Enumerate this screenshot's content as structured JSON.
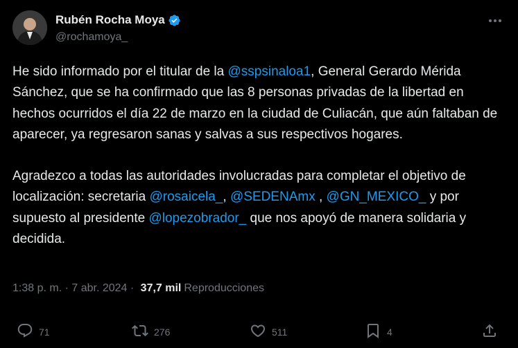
{
  "author": {
    "name": "Rubén Rocha Moya",
    "handle": "@rochamoya_"
  },
  "tweet": {
    "p1_before_mention": "He sido informado por el titular de la ",
    "p1_mention": "@sspsinaloa1",
    "p1_after": ", General Gerardo Mérida Sánchez, que se ha confirmado que las 8 personas privadas de la libertad en hechos ocurridos el día 22 de marzo en la ciudad de Culiacán, que aún faltaban de aparecer, ya regresaron sanas y salvas a sus respectivos hogares.",
    "p2_before_mentions": "Agradezco a todas las autoridades involucradas para completar el objetivo de localización: secretaria ",
    "mention_rosaicela": "@rosaicela_",
    "sep1": ", ",
    "mention_sedena": "@SEDENAmx",
    "sep2": " , ",
    "mention_gn": "@GN_MEXICO_",
    "between_gn_president": " y por supuesto al presidente ",
    "mention_amlo": "@lopezobrador_",
    "p2_end": " que nos apoyó de manera solidaria y decidida."
  },
  "meta": {
    "time": "1:38 p. m.",
    "dot1": " · ",
    "date": "7 abr. 2024",
    "dot2": " · ",
    "views_count": "37,7 mil",
    "views_label": "Reproducciones"
  },
  "actions": {
    "replies": "71",
    "retweets": "276",
    "likes": "511",
    "bookmarks": "4"
  },
  "colors": {
    "background": "#000000",
    "text": "#e7e9ea",
    "secondary": "#71767b",
    "accent": "#1d9bf0"
  },
  "icons": [
    "more-icon",
    "verified-badge-icon",
    "reply-icon",
    "retweet-icon",
    "like-icon",
    "bookmark-icon",
    "share-icon"
  ]
}
